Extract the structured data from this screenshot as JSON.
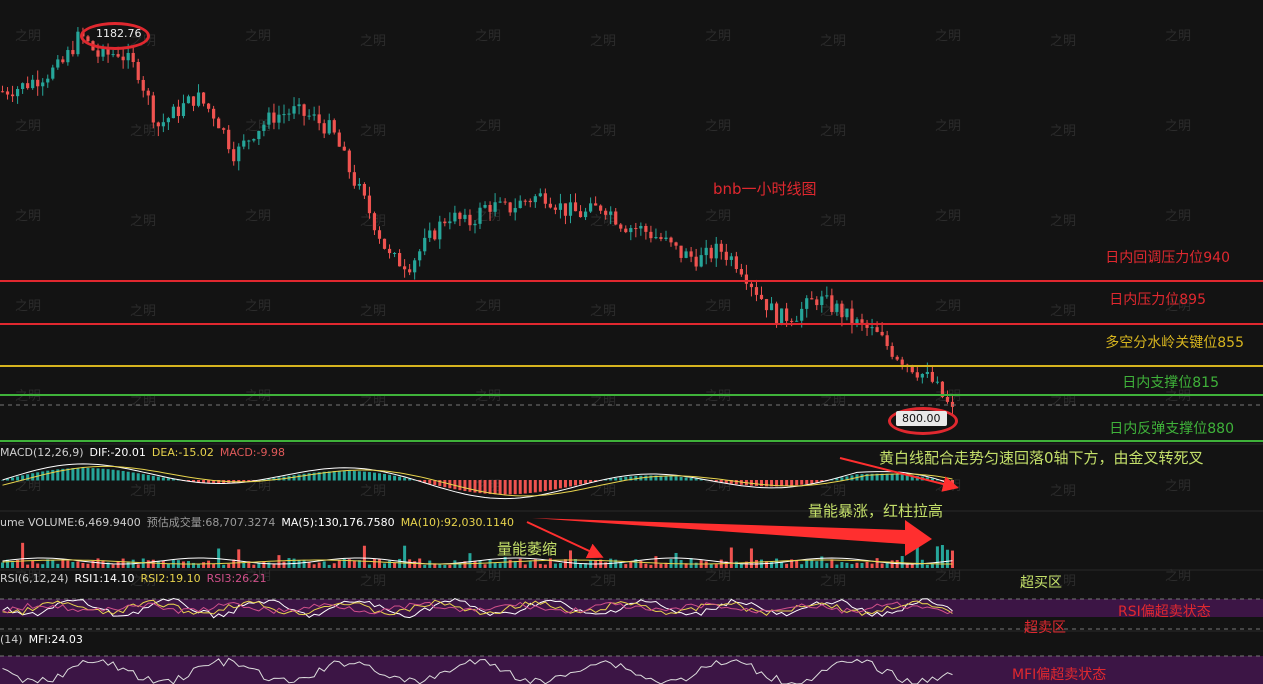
{
  "chart_data": {
    "type": "candlestick",
    "title": "bnb一小时线图",
    "price_high_label": "1182.76",
    "price_low_label": "800.00",
    "colors": {
      "up": "#26a69a",
      "down": "#ef5350",
      "red_line": "#e0282f",
      "yellow_line": "#d6b41f",
      "green_line": "#3fb23a",
      "wick": "#888888"
    },
    "levels": [
      {
        "price": 940,
        "label": "日内回调压力位940",
        "color": "#e0282f"
      },
      {
        "price": 895,
        "label": "日内压力位895",
        "color": "#e0282f"
      },
      {
        "price": 855,
        "label": "多空分水岭关键位855",
        "color": "#d6b41f"
      },
      {
        "price": 815,
        "label": "日内支撑位815",
        "color": "#3fb23a"
      },
      {
        "price": 780,
        "label": "日内反弹支撑位880",
        "color": "#3fb23a"
      }
    ],
    "price_path": [
      1125,
      1130,
      1140,
      1150,
      1182,
      1160,
      1165,
      1145,
      1090,
      1105,
      1120,
      1100,
      1060,
      1085,
      1100,
      1105,
      1098,
      1085,
      1040,
      1000,
      955,
      950,
      975,
      1000,
      990,
      1010,
      1005,
      1015,
      1020,
      1005,
      1000,
      1010,
      990,
      985,
      975,
      960,
      955,
      965,
      950,
      920,
      895,
      900,
      915,
      905,
      890,
      880,
      860,
      845,
      830,
      800
    ],
    "watermark": "之明"
  },
  "macd": {
    "label": "MACD(12,26,9)",
    "dif": "DIF:-20.01",
    "dea": "DEA:-15.02",
    "macd": "MACD:-9.98",
    "annotation": "黄白线配合走势匀速回落0轴下方，由金叉转死叉"
  },
  "volume": {
    "label": "ume VOLUME:6,469.9400",
    "pred": "预估成交量:68,707.3274",
    "ma5": "MA(5):130,176.7580",
    "ma10": "MA(10):92,030.1140",
    "annotation_surge": "量能暴涨，红柱拉高",
    "annotation_shrink": "量能萎缩"
  },
  "rsi": {
    "label": "RSI(6,12,24)",
    "rsi1": "RSI1:14.10",
    "rsi2": "RSI2:19.10",
    "rsi3": "RSI3:26.21",
    "overbought": "超买区",
    "oversold": "超卖区",
    "annotation": "RSI偏超卖状态"
  },
  "mfi": {
    "label": "(14)",
    "value": "MFI:24.03",
    "annotation": "MFI偏超卖状态"
  }
}
